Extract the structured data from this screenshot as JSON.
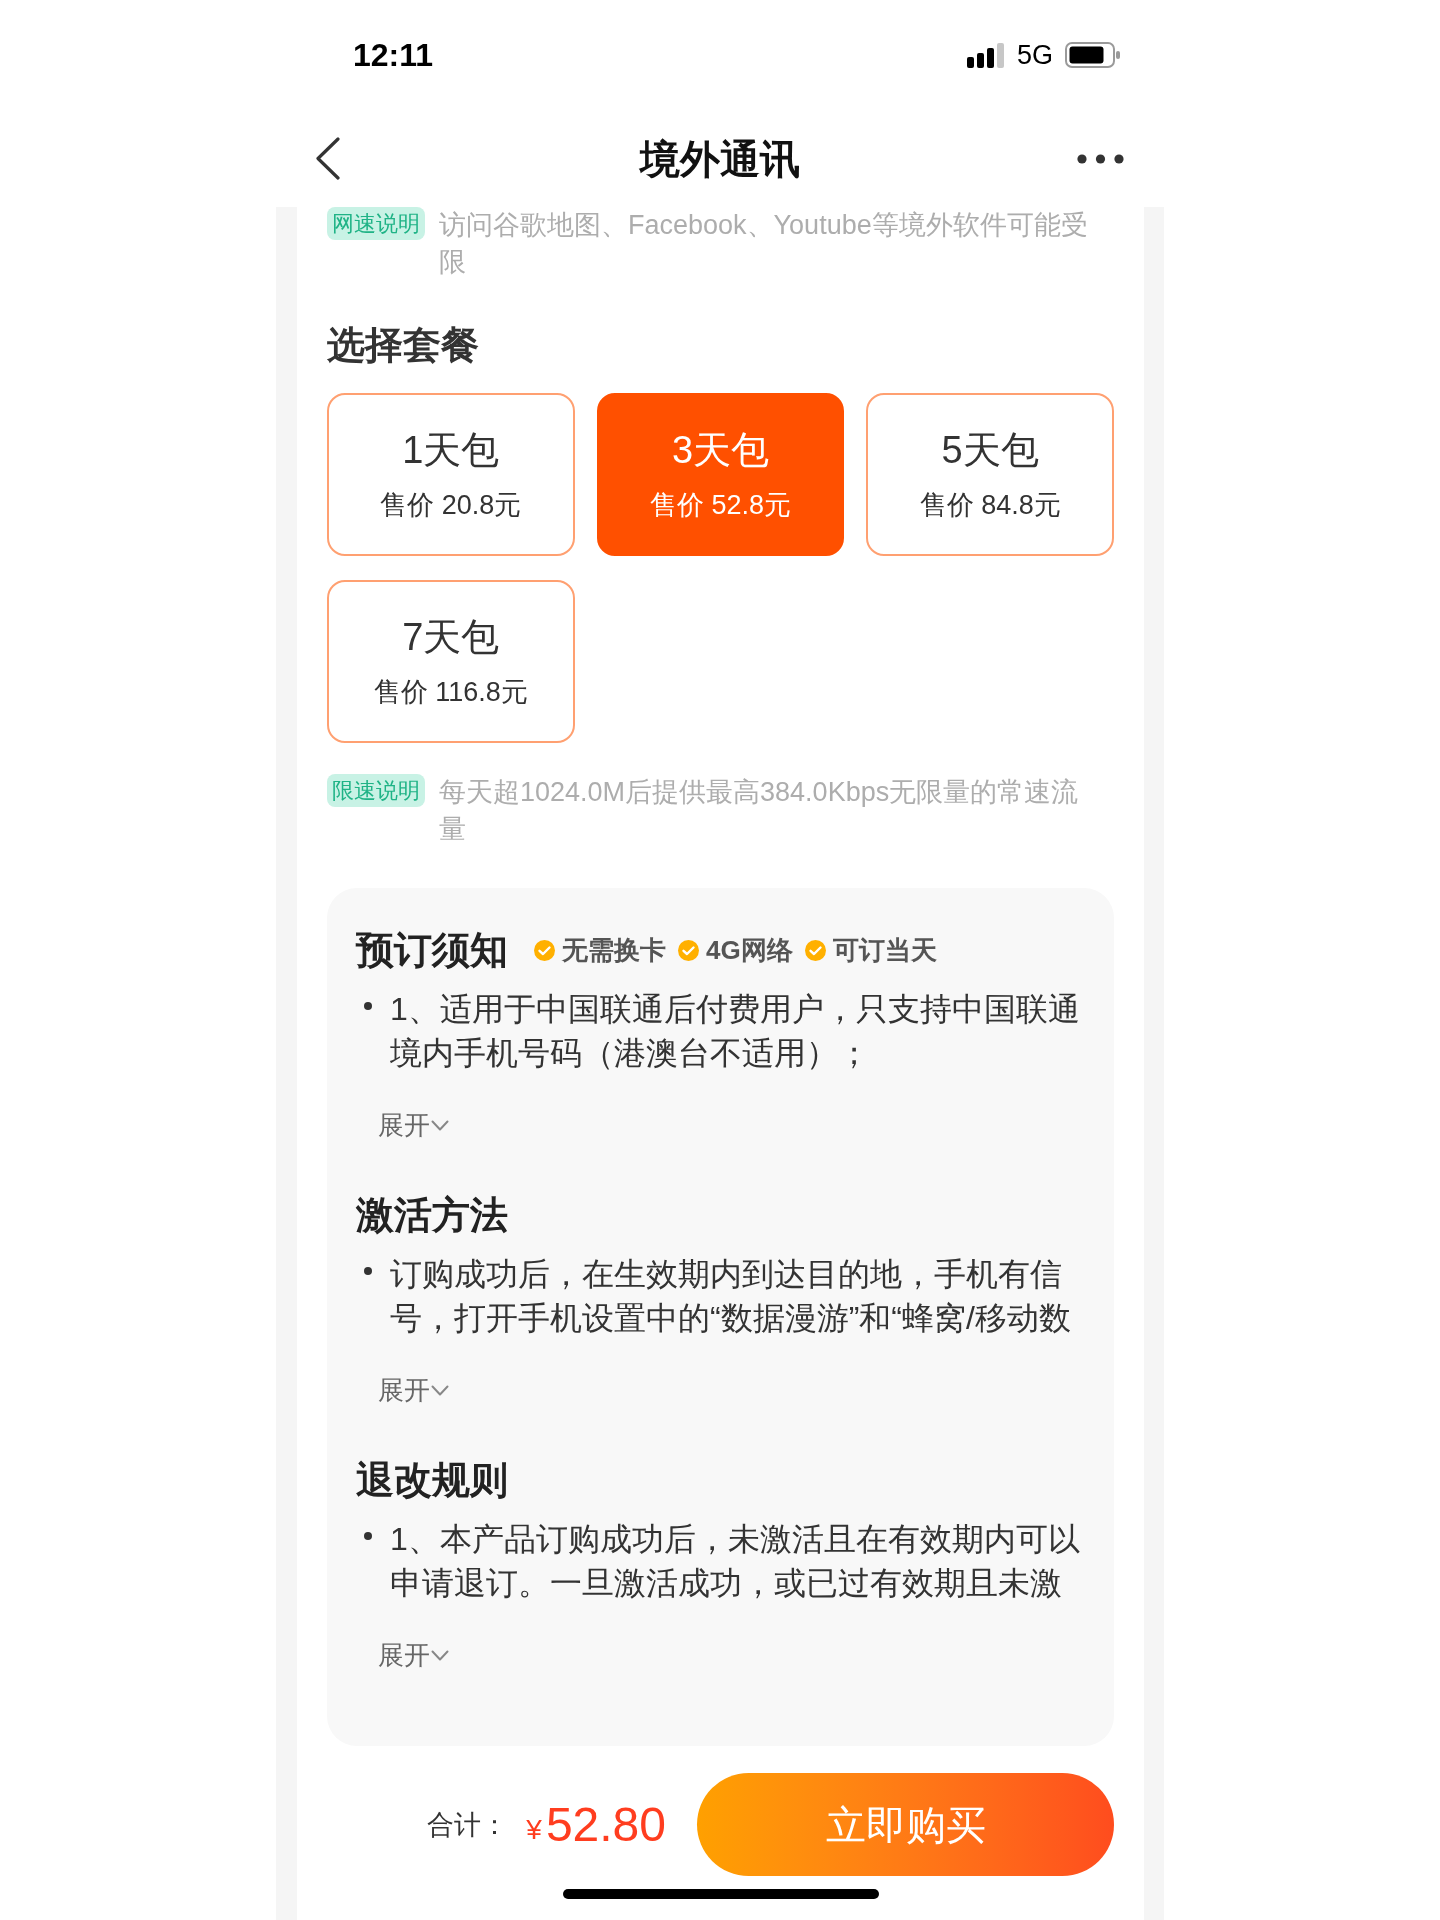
{
  "status_bar": {
    "time": "12:11",
    "network": "5G"
  },
  "nav": {
    "title": "境外通讯"
  },
  "speed_note": {
    "tag": "网速说明",
    "text": "访问谷歌地图、Facebook、Youtube等境外软件可能受限"
  },
  "package_section": {
    "title": "选择套餐",
    "packages": [
      {
        "name": "1天包",
        "price": "售价 20.8元",
        "selected": false
      },
      {
        "name": "3天包",
        "price": "售价 52.8元",
        "selected": true
      },
      {
        "name": "5天包",
        "price": "售价 84.8元",
        "selected": false
      },
      {
        "name": "7天包",
        "price": "售价 116.8元",
        "selected": false
      }
    ]
  },
  "limit_note": {
    "tag": "限速说明",
    "text": "每天超1024.0M后提供最高384.0Kbps无限量的常速流量"
  },
  "info_sections": [
    {
      "title": "预订须知",
      "badges": [
        "无需换卡",
        "4G网络",
        "可订当天"
      ],
      "items": [
        "1、适用于中国联通后付费用户，只支持中国联通境内手机号码（港澳台不适用）；"
      ],
      "expand_label": "展开"
    },
    {
      "title": "激活方法",
      "items": [
        "订购成功后，在生效期内到达目的地，手机有信号，打开手机设置中的“数据漫游”和“蜂窝/移动数"
      ],
      "expand_label": "展开"
    },
    {
      "title": "退改规则",
      "items": [
        "1、本产品订购成功后，未激活且在有效期内可以申请退订。一旦激活成功，或已过有效期且未激"
      ],
      "expand_label": "展开"
    }
  ],
  "checkout": {
    "total_label": "合计：",
    "currency": "¥",
    "amount": "52.80",
    "buy_button": "立即购买"
  }
}
